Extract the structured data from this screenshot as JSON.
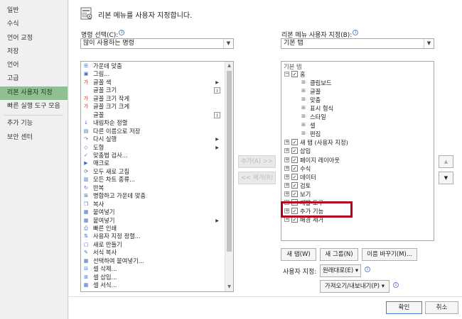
{
  "sidebar": {
    "items": [
      {
        "label": "일반"
      },
      {
        "label": "수식"
      },
      {
        "label": "언어 교정"
      },
      {
        "label": "저장"
      },
      {
        "label": "언어"
      },
      {
        "label": "고급"
      },
      {
        "label": "리본 사용자 지정",
        "active": true
      },
      {
        "label": "빠른 실행 도구 모음"
      },
      {
        "label": "추가 기능"
      },
      {
        "label": "보안 센터"
      }
    ]
  },
  "header": {
    "title": "리본 메뉴를 사용자 지정합니다.",
    "icon": "ribbon-customize-icon"
  },
  "left_panel": {
    "label": "명령 선택(C):",
    "combo_value": "많이 사용하는 명령",
    "commands": [
      {
        "label": "가운데 맞춤",
        "icon": "align-center-icon",
        "glyph": "☰"
      },
      {
        "label": "그림...",
        "icon": "picture-icon",
        "glyph": "▣"
      },
      {
        "label": "글꼴 색",
        "icon": "font-color-icon",
        "glyph": "가",
        "sub": "arrow"
      },
      {
        "label": "글꼴 크기",
        "icon": "font-size-icon",
        "glyph": "",
        "sub": "box"
      },
      {
        "label": "글꼴 크기 작게",
        "icon": "font-size-decrease-icon",
        "glyph": "가"
      },
      {
        "label": "글꼴 크기 크게",
        "icon": "font-size-increase-icon",
        "glyph": "가"
      },
      {
        "label": "글꼴",
        "icon": "font-icon",
        "glyph": "",
        "sub": "box"
      },
      {
        "label": "내림차순 정렬",
        "icon": "sort-descending-icon",
        "glyph": "↓"
      },
      {
        "label": "다른 이름으로 저장",
        "icon": "save-as-icon",
        "glyph": "▤"
      },
      {
        "label": "다시 실행",
        "icon": "redo-icon",
        "glyph": "↷",
        "sub": "arrow"
      },
      {
        "label": "도형",
        "icon": "shapes-icon",
        "glyph": "◇",
        "sub": "arrow"
      },
      {
        "label": "맞춤법 검사...",
        "icon": "spell-check-icon",
        "glyph": "✓"
      },
      {
        "label": "매크로",
        "icon": "macro-icon",
        "glyph": "▶"
      },
      {
        "label": "모두 새로 고침",
        "icon": "refresh-all-icon",
        "glyph": "⟳"
      },
      {
        "label": "모든 차트 종류...",
        "icon": "chart-types-icon",
        "glyph": "▥"
      },
      {
        "label": "반복",
        "icon": "repeat-icon",
        "glyph": "↻"
      },
      {
        "label": "병합하고 가운데 맞춤",
        "icon": "merge-center-icon",
        "glyph": "⊞"
      },
      {
        "label": "복사",
        "icon": "copy-icon",
        "glyph": "❐"
      },
      {
        "label": "붙여넣기",
        "icon": "paste-icon",
        "glyph": "▦"
      },
      {
        "label": "붙여넣기",
        "icon": "paste-options-icon",
        "glyph": "▦",
        "sub": "arrow"
      },
      {
        "label": "빠른 인쇄",
        "icon": "quick-print-icon",
        "glyph": "⎙"
      },
      {
        "label": "사용자 지정 정렬...",
        "icon": "custom-sort-icon",
        "glyph": "⇅"
      },
      {
        "label": "새로 만들기",
        "icon": "new-file-icon",
        "glyph": "▢"
      },
      {
        "label": "서식 복사",
        "icon": "format-painter-icon",
        "glyph": "✎"
      },
      {
        "label": "선택하여 붙여넣기...",
        "icon": "paste-special-icon",
        "glyph": "▦"
      },
      {
        "label": "셀 삭제...",
        "icon": "delete-cells-icon",
        "glyph": "⊟"
      },
      {
        "label": "셀 삽입...",
        "icon": "insert-cells-icon",
        "glyph": "⊞"
      },
      {
        "label": "셀 서식...",
        "icon": "format-cells-icon",
        "glyph": "▦"
      }
    ]
  },
  "middle": {
    "add_label": "추가(A) >>",
    "remove_label": "<< 제거(R)"
  },
  "right_panel": {
    "label": "리본 메뉴 사용자 지정(B):",
    "combo_value": "기본 탭",
    "tree_header": "기본 탭",
    "tree": [
      {
        "label": "홈",
        "level": 0,
        "expander": "−",
        "checked": true
      },
      {
        "label": "클립보드",
        "level": 1
      },
      {
        "label": "글꼴",
        "level": 1
      },
      {
        "label": "맞춤",
        "level": 1
      },
      {
        "label": "표시 형식",
        "level": 1
      },
      {
        "label": "스타일",
        "level": 1
      },
      {
        "label": "셀",
        "level": 1
      },
      {
        "label": "편집",
        "level": 1
      },
      {
        "label": "새 탭 (사용자 지정)",
        "level": 0,
        "expander": "+",
        "checked": true
      },
      {
        "label": "삽입",
        "level": 0,
        "expander": "+",
        "checked": true
      },
      {
        "label": "페이지 레이아웃",
        "level": 0,
        "expander": "+",
        "checked": true
      },
      {
        "label": "수식",
        "level": 0,
        "expander": "+",
        "checked": true
      },
      {
        "label": "데이터",
        "level": 0,
        "expander": "+",
        "checked": true
      },
      {
        "label": "검토",
        "level": 0,
        "expander": "+",
        "checked": true
      },
      {
        "label": "보기",
        "level": 0,
        "expander": "+",
        "checked": true
      },
      {
        "label": "개발 도구",
        "level": 0,
        "expander": "+",
        "checked": true
      },
      {
        "label": "추가 기능",
        "level": 0,
        "expander": "+",
        "checked": true
      },
      {
        "label": "배경 제거",
        "level": 0,
        "expander": "+",
        "checked": true
      }
    ],
    "new_tab_label": "새 탭(W)",
    "new_group_label": "새 그룹(N)",
    "rename_label": "이름 바꾸기(M)...",
    "customize_label": "사용자 지정:",
    "reset_label": "원래대로(E) ▾",
    "import_export_label": "가져오기/내보내기(P) ▾"
  },
  "footer": {
    "ok_label": "확인",
    "cancel_label": "취소"
  },
  "colors": {
    "active_nav": "#8fbf93",
    "highlight": "#b00020",
    "accent": "#4a7bd0"
  }
}
